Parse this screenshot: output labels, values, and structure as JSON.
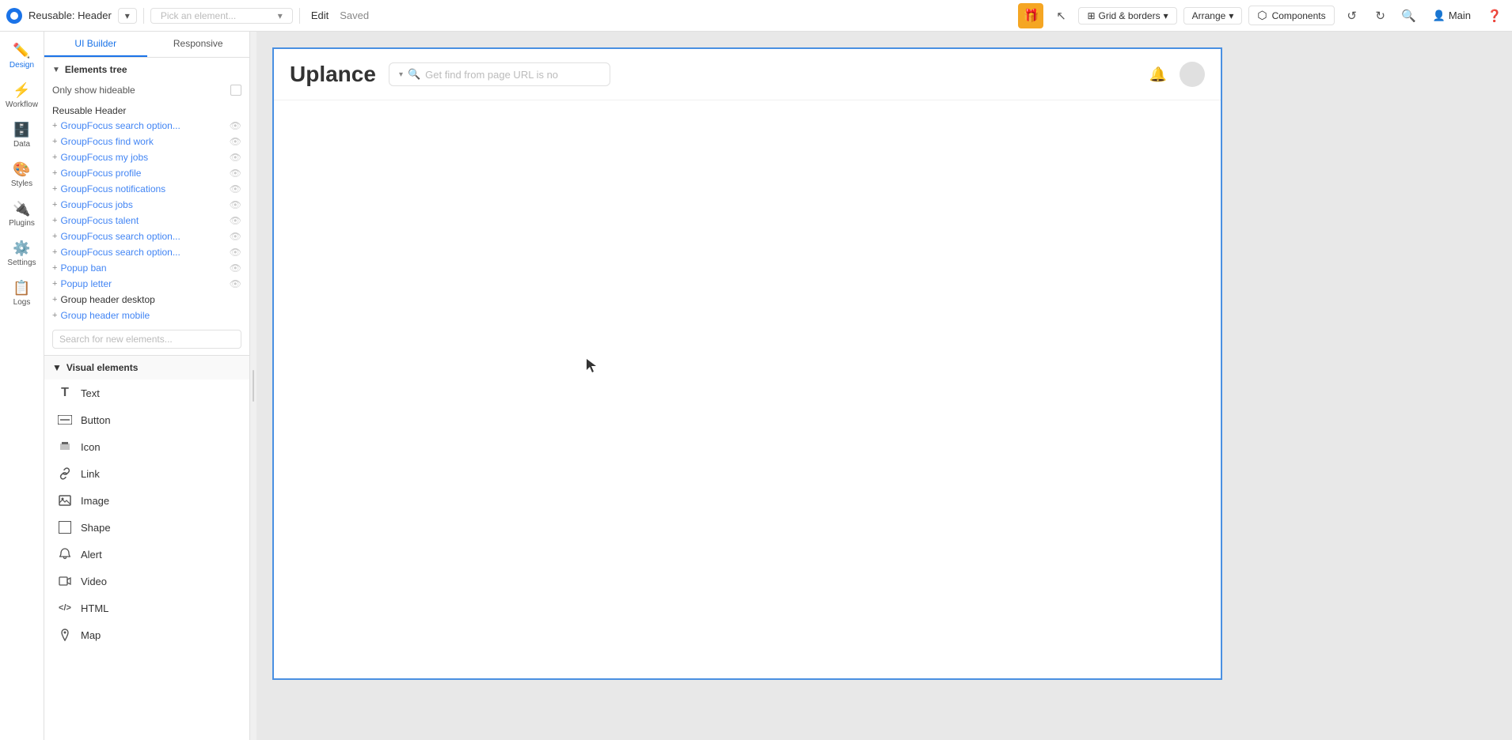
{
  "topbar": {
    "logo_text": "b",
    "app_name": "Reusable: Header",
    "dropdown_arrow": "▾",
    "pick_placeholder": "Pick an element...",
    "edit_label": "Edit",
    "saved_label": "Saved",
    "grid_borders_label": "Grid & borders",
    "arrange_label": "Arrange",
    "components_label": "Components",
    "main_label": "Main",
    "undo_icon": "↺",
    "redo_icon": "↻",
    "search_icon": "🔍",
    "help_icon": "?"
  },
  "icon_sidebar": {
    "items": [
      {
        "id": "design",
        "label": "Design",
        "icon": "✏️",
        "active": true
      },
      {
        "id": "workflow",
        "label": "Workflow",
        "icon": "⚡",
        "active": false
      },
      {
        "id": "data",
        "label": "Data",
        "icon": "🗄️",
        "active": false
      },
      {
        "id": "styles",
        "label": "Styles",
        "icon": "🎨",
        "active": false
      },
      {
        "id": "plugins",
        "label": "Plugins",
        "icon": "🔌",
        "active": false
      },
      {
        "id": "settings",
        "label": "Settings",
        "icon": "⚙️",
        "active": false
      },
      {
        "id": "logs",
        "label": "Logs",
        "icon": "📋",
        "active": false
      }
    ]
  },
  "panel": {
    "tabs": [
      {
        "id": "ui-builder",
        "label": "UI Builder",
        "active": true
      },
      {
        "id": "responsive",
        "label": "Responsive",
        "active": false
      }
    ],
    "elements_tree": {
      "section_label": "Elements tree",
      "hideable_label": "Only show hideable",
      "reusable_header_label": "Reusable Header",
      "items": [
        {
          "label": "GroupFocus search option...",
          "prefix": "+",
          "has_eye": true
        },
        {
          "label": "GroupFocus find work",
          "prefix": "+",
          "has_eye": true
        },
        {
          "label": "GroupFocus my jobs",
          "prefix": "+",
          "has_eye": true
        },
        {
          "label": "GroupFocus profile",
          "prefix": "+",
          "has_eye": true
        },
        {
          "label": "GroupFocus notifications",
          "prefix": "+",
          "has_eye": true
        },
        {
          "label": "GroupFocus jobs",
          "prefix": "+",
          "has_eye": true
        },
        {
          "label": "GroupFocus talent",
          "prefix": "+",
          "has_eye": true
        },
        {
          "label": "GroupFocus search option...",
          "prefix": "+",
          "has_eye": true
        },
        {
          "label": "GroupFocus search option...",
          "prefix": "+",
          "has_eye": true
        },
        {
          "label": "Popup ban",
          "prefix": "+",
          "has_eye": true
        },
        {
          "label": "Popup letter",
          "prefix": "+",
          "has_eye": true
        },
        {
          "label": "Group header desktop",
          "prefix": "+",
          "has_eye": false,
          "dark": true
        },
        {
          "label": "Group header mobile",
          "prefix": "+",
          "has_eye": false,
          "dark": false
        }
      ],
      "search_placeholder": "Search for new elements..."
    },
    "visual_elements": {
      "section_label": "Visual elements",
      "items": [
        {
          "id": "text",
          "label": "Text",
          "icon": "T"
        },
        {
          "id": "button",
          "label": "Button",
          "icon": "btn"
        },
        {
          "id": "icon",
          "label": "Icon",
          "icon": "flag"
        },
        {
          "id": "link",
          "label": "Link",
          "icon": "link"
        },
        {
          "id": "image",
          "label": "Image",
          "icon": "img"
        },
        {
          "id": "shape",
          "label": "Shape",
          "icon": "shape"
        },
        {
          "id": "alert",
          "label": "Alert",
          "icon": "bell"
        },
        {
          "id": "video",
          "label": "Video",
          "icon": "video"
        },
        {
          "id": "html",
          "label": "HTML",
          "icon": "html"
        },
        {
          "id": "map",
          "label": "Map",
          "icon": "map"
        }
      ]
    }
  },
  "canvas": {
    "logo_text": "Uplance",
    "search_placeholder": "Get find from page URL is no",
    "search_arrow": "▾",
    "search_icon": "🔍"
  }
}
